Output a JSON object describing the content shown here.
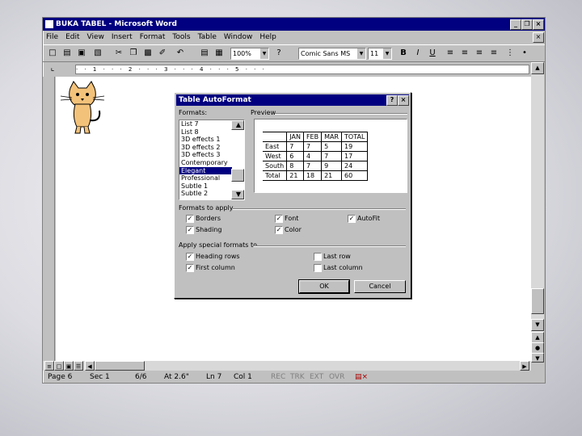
{
  "window": {
    "title": "BUKA TABEL - Microsoft Word",
    "min": "_",
    "restore": "❐",
    "close": "×"
  },
  "menu": [
    "File",
    "Edit",
    "View",
    "Insert",
    "Format",
    "Tools",
    "Table",
    "Window",
    "Help"
  ],
  "toolbar": {
    "zoom": "100%",
    "font": "Comic Sans MS",
    "size": "11",
    "bold": "B",
    "italic": "I",
    "underline": "U"
  },
  "ruler_marks": "· · 1 · · · 2 · · · 3 · · · 4 · · · 5 · · ·",
  "status": {
    "page": "Page 6",
    "sec": "Sec 1",
    "of": "6/6",
    "at": "At 2.6\"",
    "ln": "Ln 7",
    "col": "Col 1",
    "rec": "REC",
    "trk": "TRK",
    "ext": "EXT",
    "ovr": "OVR"
  },
  "dialog": {
    "title": "Table AutoFormat",
    "help": "?",
    "close": "×",
    "formats_label": "Formats:",
    "formats": [
      "List 7",
      "List 8",
      "3D effects 1",
      "3D effects 2",
      "3D effects 3",
      "Contemporary",
      "Elegant",
      "Professional",
      "Subtle 1",
      "Subtle 2"
    ],
    "selected_format": "Elegant",
    "preview_label": "Preview",
    "preview_table": [
      [
        "",
        "JAN",
        "FEB",
        "MAR",
        "TOTAL"
      ],
      [
        "East",
        "7",
        "7",
        "5",
        "19"
      ],
      [
        "West",
        "6",
        "4",
        "7",
        "17"
      ],
      [
        "South",
        "8",
        "7",
        "9",
        "24"
      ],
      [
        "Total",
        "21",
        "18",
        "21",
        "60"
      ]
    ],
    "apply_label": "Formats to apply",
    "apply": {
      "borders": "Borders",
      "shading": "Shading",
      "font": "Font",
      "color": "Color",
      "autofit": "AutoFit"
    },
    "special_label": "Apply special formats to",
    "special": {
      "heading_rows": "Heading rows",
      "first_column": "First column",
      "last_row": "Last row",
      "last_column": "Last column"
    },
    "ok": "OK",
    "cancel": "Cancel",
    "check": "✓"
  }
}
